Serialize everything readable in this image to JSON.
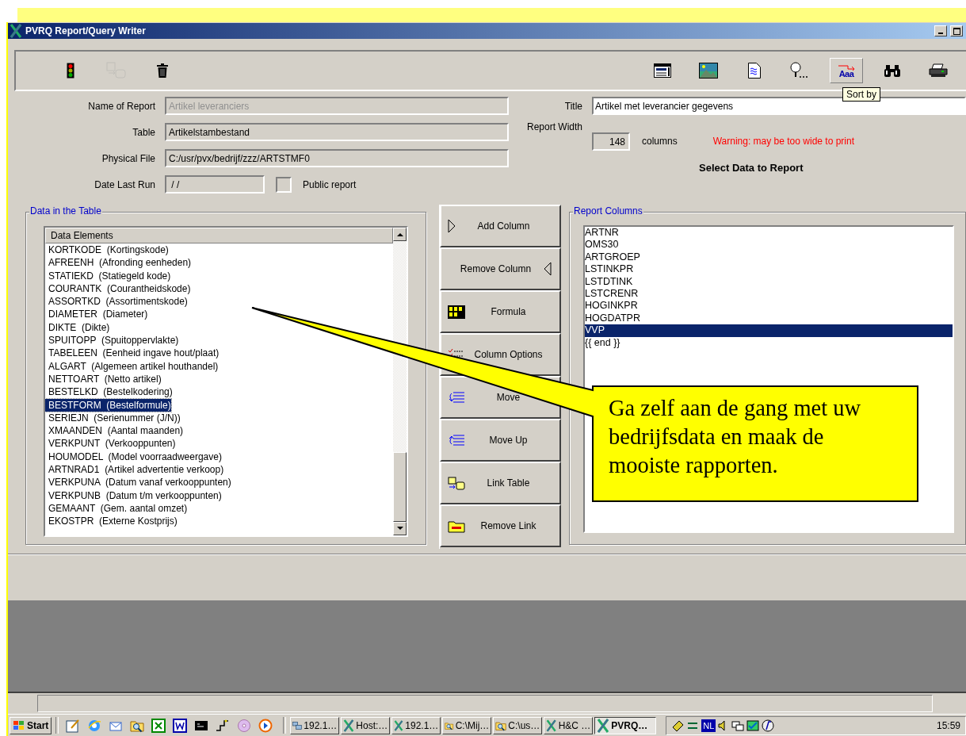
{
  "window": {
    "title": "PVRQ Report/Query Writer"
  },
  "toolbar": {
    "left": [
      {
        "kind": "traffic-light",
        "disabled": false
      },
      {
        "kind": "link",
        "disabled": true
      },
      {
        "kind": "trash",
        "disabled": false
      }
    ],
    "right": [
      {
        "kind": "form",
        "selected": false
      },
      {
        "kind": "picture",
        "selected": false
      },
      {
        "kind": "document",
        "selected": false
      },
      {
        "kind": "magnifier",
        "selected": false
      },
      {
        "kind": "sort",
        "label": "Aaa",
        "selected": true
      },
      {
        "kind": "binoculars",
        "selected": false
      },
      {
        "kind": "printer",
        "selected": false
      }
    ],
    "tooltip": "Sort by"
  },
  "form": {
    "name_of_report": {
      "label": "Name of Report",
      "value": "Artikel leveranciers",
      "disabled": true
    },
    "table": {
      "label": "Table",
      "value": "Artikelstambestand"
    },
    "physical_file": {
      "label": "Physical File",
      "value": "C:/usr/pvx/bedrijf/zzz/ARTSTMF0"
    },
    "date_last_run": {
      "label": "Date Last Run",
      "value": "/ /"
    },
    "public_report": {
      "label": "Public report",
      "checked": false
    },
    "title": {
      "label": "Title",
      "value": "Artikel met leverancier gegevens"
    },
    "report_width": {
      "label": "Report Width",
      "value": "148",
      "unit": "columns"
    },
    "warning": "Warning: may be too wide to print",
    "heading": "Select Data to Report"
  },
  "data_group": {
    "legend": "Data in the Table",
    "header": "Data Elements",
    "items": [
      {
        "label": "KORTKODE  (Kortingskode)",
        "selected": false
      },
      {
        "label": "AFREENH  (Afronding eenheden)",
        "selected": false
      },
      {
        "label": "STATIEKD  (Statiegeld kode)",
        "selected": false
      },
      {
        "label": "COURANTK  (Courantheidskode)",
        "selected": false
      },
      {
        "label": "ASSORTKD  (Assortimentskode)",
        "selected": false
      },
      {
        "label": "DIAMETER  (Diameter)",
        "selected": false
      },
      {
        "label": "DIKTE  (Dikte)",
        "selected": false
      },
      {
        "label": "SPUITOPP  (Spuitoppervlakte)",
        "selected": false
      },
      {
        "label": "TABELEEN  (Eenheid ingave hout/plaat)",
        "selected": false
      },
      {
        "label": "ALGART  (Algemeen artikel houthandel)",
        "selected": false
      },
      {
        "label": "NETTOART  (Netto artikel)",
        "selected": false
      },
      {
        "label": "BESTELKD  (Bestelkodering)",
        "selected": false
      },
      {
        "label": "BESTFORM  (Bestelformule)",
        "selected": true
      },
      {
        "label": "SERIEJN  (Serienummer (J/N))",
        "selected": false
      },
      {
        "label": "XMAANDEN  (Aantal maanden)",
        "selected": false
      },
      {
        "label": "VERKPUNT  (Verkooppunten)",
        "selected": false
      },
      {
        "label": "HOUMODEL  (Model voorraadweergave)",
        "selected": false
      },
      {
        "label": "ARTNRAD1  (Artikel advertentie verkoop)",
        "selected": false
      },
      {
        "label": "VERKPUNA  (Datum vanaf verkooppunten)",
        "selected": false
      },
      {
        "label": "VERKPUNB  (Datum t/m verkooppunten)",
        "selected": false
      },
      {
        "label": "GEMAANT  (Gem. aantal omzet)",
        "selected": false
      },
      {
        "label": "EKOSTPR  (Externe Kostprijs)",
        "selected": false
      }
    ]
  },
  "buttons": [
    {
      "kind": "add",
      "label": "Add Column"
    },
    {
      "kind": "remove",
      "label": "Remove Column"
    },
    {
      "kind": "formula",
      "label": "Formula"
    },
    {
      "kind": "options",
      "label": "Column Options"
    },
    {
      "kind": "move-down",
      "label": "Move"
    },
    {
      "kind": "move-up",
      "label": "Move Up"
    },
    {
      "kind": "link",
      "label": "Link Table"
    },
    {
      "kind": "unlink",
      "label": "Remove Link"
    }
  ],
  "report_group": {
    "legend": "Report Columns",
    "items": [
      {
        "label": "ARTNR",
        "selected": false
      },
      {
        "label": "OMS30",
        "selected": false
      },
      {
        "label": "ARTGROEP",
        "selected": false
      },
      {
        "label": "LSTINKPR",
        "selected": false
      },
      {
        "label": "LSTDTINK",
        "selected": false
      },
      {
        "label": "LSTCRENR",
        "selected": false
      },
      {
        "label": "HOGINKPR",
        "selected": false
      },
      {
        "label": "HOGDATPR",
        "selected": false
      },
      {
        "label": "VVP",
        "selected": true
      },
      {
        "label": "{{ end }}",
        "selected": false
      }
    ]
  },
  "callout": {
    "text": "Ga zelf aan de gang met uw bedrijfsdata en maak de mooiste rapporten."
  },
  "taskbar": {
    "start": "Start",
    "quick_launch": [
      {
        "kind": "notepad"
      },
      {
        "kind": "browser"
      },
      {
        "kind": "mail"
      },
      {
        "kind": "folder-search"
      },
      {
        "kind": "spreadsheet"
      },
      {
        "kind": "word"
      },
      {
        "kind": "console"
      },
      {
        "kind": "wave"
      },
      {
        "kind": "disc"
      },
      {
        "kind": "media"
      }
    ],
    "tasks": [
      {
        "kind": "network",
        "label": "192.1…",
        "selected": false
      },
      {
        "kind": "x",
        "label": "Host:…",
        "selected": false
      },
      {
        "kind": "x",
        "label": "192.1…",
        "selected": false
      },
      {
        "kind": "folder-search",
        "label": "C:\\Mij…",
        "selected": false
      },
      {
        "kind": "folder-search",
        "label": "C:\\us…",
        "selected": false
      },
      {
        "kind": "x",
        "label": "H&C …",
        "selected": false
      },
      {
        "kind": "x",
        "label": "PVRQ…",
        "selected": true
      }
    ],
    "language": "NL",
    "clock": "15:59"
  }
}
